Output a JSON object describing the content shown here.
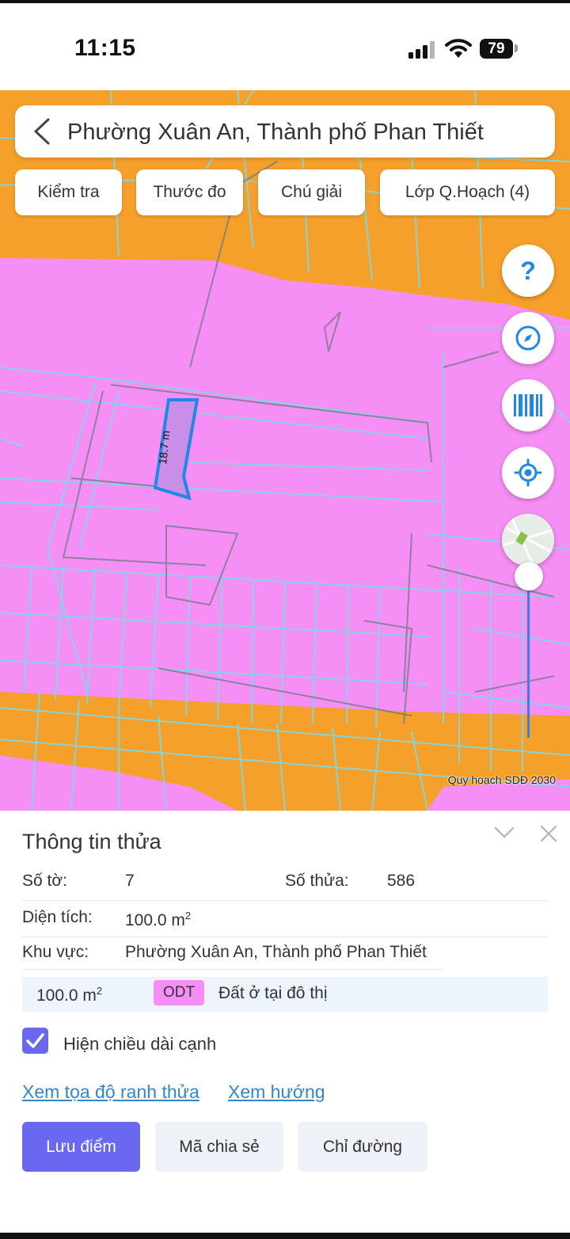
{
  "status": {
    "time": "11:15",
    "battery": "79"
  },
  "map": {
    "location_title": "Phường Xuân An, Thành phố Phan Thiết",
    "tools": [
      "Kiểm tra",
      "Thước đo",
      "Chú giải",
      "Lớp Q.Hoạch (4)"
    ],
    "help_glyph": "?",
    "edge_length_label": "18.7 m",
    "caption": "Quy hoạch SDĐ 2030",
    "colors": {
      "residential": "#f58ef5",
      "orange_zone": "#f5a02b",
      "parcel_line": "#7fd9e6",
      "selected_parcel": "#1e88e5"
    },
    "controls": [
      "help-icon",
      "compass-icon",
      "barcode-icon",
      "locate-icon",
      "basemap-thumbnail",
      "zoom-slider"
    ]
  },
  "sheet": {
    "title": "Thông tin thửa",
    "so_to_label": "Số tờ:",
    "so_to_value": "7",
    "so_thua_label": "Số thửa:",
    "so_thua_value": "586",
    "dien_tich_label": "Diện tích:",
    "dien_tich_value": "100.0 m",
    "area_unit_exp": "2",
    "khu_vuc_label": "Khu vực:",
    "khu_vuc_value": "Phường Xuân An, Thành phố Phan Thiết",
    "land_area": "100.0 m",
    "land_code": "ODT",
    "land_desc": "Đất ở tại đô thị",
    "show_edge_label": "Hiện chiều dài cạnh",
    "show_edge_checked": true,
    "link_coords": "Xem tọa độ ranh thửa",
    "link_direction": "Xem hướng",
    "btn_save": "Lưu điểm",
    "btn_share": "Mã chia sẻ",
    "btn_route": "Chỉ đường"
  }
}
